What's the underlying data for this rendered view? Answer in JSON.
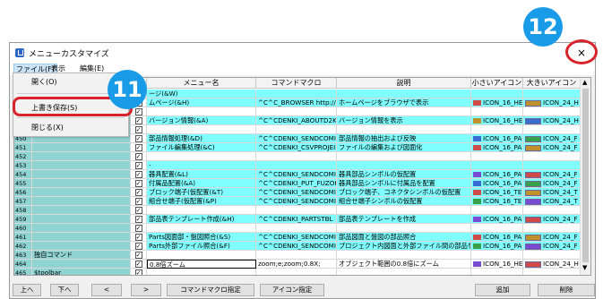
{
  "window": {
    "title": "メニューカスタマイズ",
    "close_glyph": "×"
  },
  "menubar": {
    "file": "ファイル(F)",
    "view": "表示",
    "edit": "編集(E)"
  },
  "columns": [
    "メニュー名",
    "コマンドマクロ",
    "説明",
    "小さいアイコン",
    "大きいアイコン"
  ],
  "dropdown": {
    "items": [
      "開く(O)",
      "上書き保存(S)",
      "閉じる(X)"
    ]
  },
  "rows": [
    {
      "num": "",
      "a": "",
      "name": "ージ(&W)",
      "macro": "",
      "desc": "",
      "small": "",
      "large": "",
      "hl": true
    },
    {
      "num": "",
      "a": "",
      "name": "ムページ(&H)",
      "macro": "^C^C_BROWSER http://",
      "desc": "ホームページをブラウザで表示",
      "small": "ICON_16_HELI",
      "large": "ICON_24_H",
      "hl": true
    },
    {
      "num": "",
      "a": "",
      "name": "",
      "macro": "",
      "desc": "",
      "small": "",
      "large": "",
      "hl": false
    },
    {
      "num": "",
      "a": "",
      "name": "バージョン情報(&A)",
      "macro": "^C^CDENKI_ABOUTD2K",
      "desc": "バージョン情報を表示",
      "small": "ICON_16_HELI",
      "large": "ICON_24_H",
      "hl": true
    },
    {
      "num": "",
      "a": "",
      "name": "",
      "macro": "",
      "desc": "",
      "small": "",
      "large": "",
      "hl": false
    },
    {
      "num": "450",
      "a": "",
      "name": "部品情報処理(&D)",
      "macro": "^C^CDENKI_SENDCOMI",
      "desc": "部品情報の抽出および反映",
      "small": "ICON_16_PAR",
      "large": "ICON_24_F",
      "hl": true
    },
    {
      "num": "451",
      "a": "",
      "name": "ファイル編集処理(&C)",
      "macro": "^C^CDENKI_CSVPROJEI",
      "desc": "ファイルの編集および図面化",
      "small": "ICON_16_PAR",
      "large": "ICON_24_F",
      "hl": true
    },
    {
      "num": "452",
      "a": "",
      "name": "",
      "macro": "",
      "desc": "",
      "small": "",
      "large": "",
      "hl": false
    },
    {
      "num": "453",
      "a": "",
      "name": "-",
      "macro": "",
      "desc": "",
      "small": "",
      "large": "",
      "hl": true
    },
    {
      "num": "454",
      "a": "",
      "name": "器具配置(&L)",
      "macro": "^C^CDENKI_SENDCOMI",
      "desc": "器具部品シンボルの仮配置",
      "small": "ICON_16_PAR",
      "large": "ICON_24_F",
      "hl": true
    },
    {
      "num": "455",
      "a": "",
      "name": "付属品配置(&A)",
      "macro": "^C^CDENKI_PUT_FUZOK",
      "desc": "器具部品シンボルに付属品を配置",
      "small": "ICON_16_PAR",
      "large": "ICON_24_F",
      "hl": true
    },
    {
      "num": "456",
      "a": "",
      "name": "ブロック端子(仮配置(&T)",
      "macro": "^C^CDENKI_SENDCOMI",
      "desc": "ブロック端子、コネクタシンボルの仮配置",
      "small": "ICON_16_TER",
      "large": "ICON_24_T",
      "hl": true
    },
    {
      "num": "457",
      "a": "",
      "name": "組合せ端子(仮配置(&P)",
      "macro": "^C^CDENKI_SENDCOMI",
      "desc": "組合せ端子シンボルの仮配置",
      "small": "ICON_16_TER",
      "large": "ICON_24_T",
      "hl": true
    },
    {
      "num": "458",
      "a": "",
      "name": "",
      "macro": "",
      "desc": "",
      "small": "",
      "large": "",
      "hl": false
    },
    {
      "num": "459",
      "a": "",
      "name": "部品表テンプレート作成(&H)",
      "macro": "^C^CDENKI_PARTSTBL",
      "desc": "部品表テンプレートを作成",
      "small": "ICON_16_PAR",
      "large": "ICON_24_F",
      "hl": true
    },
    {
      "num": "460",
      "a": "",
      "name": "",
      "macro": "",
      "desc": "",
      "small": "",
      "large": "",
      "hl": false
    },
    {
      "num": "461",
      "a": "",
      "name": "Parts図面部・盤図照合(&S)",
      "macro": "^C^CDENKI_SENDCOMI",
      "desc": "部品図面と盤図の部品照合",
      "small": "ICON_16_PAR",
      "large": "ICON_24_F",
      "hl": true
    },
    {
      "num": "462",
      "a": "",
      "name": "Parts外部ファイル照合(&F)",
      "macro": "^C^CDENKI_SENDCOMI",
      "desc": "プロジェクト内図面と外部ファイル間の部品を",
      "small": "ICON_16_PAR",
      "large": "ICON_24_F",
      "hl": true
    },
    {
      "num": "463",
      "a": "独自コマンド",
      "name": "",
      "macro": "",
      "desc": "",
      "small": "",
      "large": "",
      "hl": false
    },
    {
      "num": "464",
      "a": "",
      "name": "0.8倍ズーム",
      "macro": "zoom;e;zoom;0.8X;",
      "desc": "オブジェクト範囲の0.8倍にズーム",
      "small": "ICON_16_HELI",
      "large": "ICON_24_H",
      "hl": false,
      "edit": true
    },
    {
      "num": "465",
      "a": "$toolbar",
      "name": "",
      "macro": "",
      "desc": "",
      "small": "",
      "large": "",
      "hl": false
    }
  ],
  "buttons": {
    "up": "上へ",
    "down": "下へ",
    "left": "<",
    "right": ">",
    "macro": "コマンドマクロ指定",
    "icon": "アイコン指定",
    "add": "追加",
    "delete": "削除"
  },
  "badges": {
    "b11": "11",
    "b12": "12"
  },
  "colors": {
    "highlight": "#7fffff",
    "badge": "#1a9be8",
    "ring": "#d8232a"
  }
}
